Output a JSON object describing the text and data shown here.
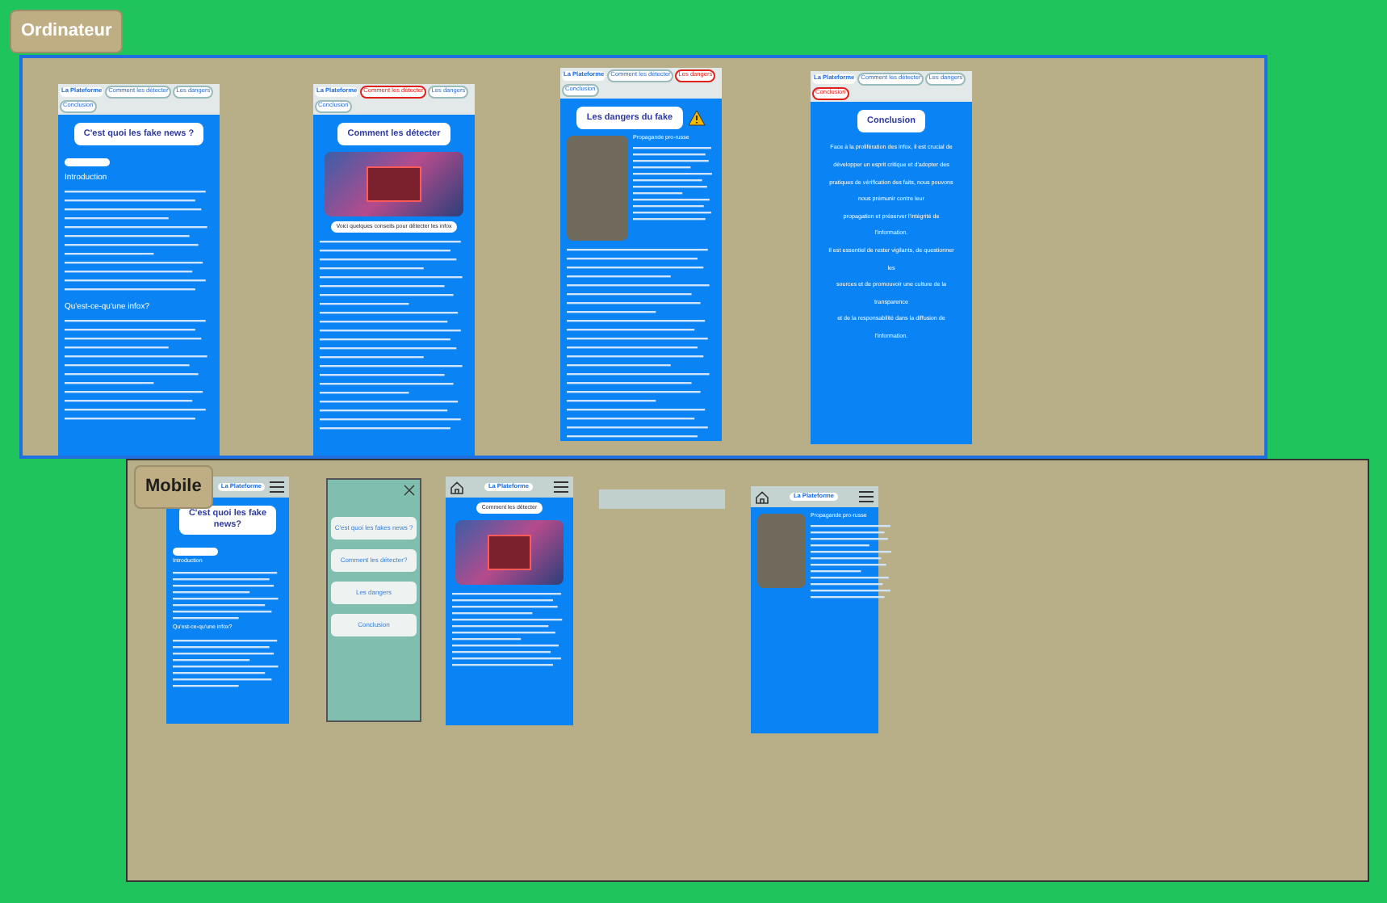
{
  "sections": [
    {
      "kind": "desktop",
      "label": "Ordinateur",
      "frames": [
        {
          "blocks": [
            {
              "kind": "nav",
              "brand": "La Plateforme",
              "tabs": [
                {
                  "label": "Comment les détecter",
                  "selected": false
                },
                {
                  "label": "Les dangers",
                  "selected": false
                },
                {
                  "label": "Conclusion",
                  "selected": false
                }
              ]
            },
            {
              "kind": "title",
              "text": "C'est quoi les fake news ?"
            },
            {
              "kind": "pill_blank"
            },
            {
              "kind": "heading",
              "text": "Introduction"
            },
            {
              "kind": "lines"
            },
            {
              "kind": "heading",
              "text": "Qu'est-ce-qu'une infox?"
            },
            {
              "kind": "lines"
            }
          ]
        },
        {
          "blocks": [
            {
              "kind": "nav",
              "brand": "La Plateforme",
              "tabs": [
                {
                  "label": "Comment les détecter",
                  "selected": true
                },
                {
                  "label": "Les dangers",
                  "selected": false
                },
                {
                  "label": "Conclusion",
                  "selected": false
                }
              ]
            },
            {
              "kind": "title",
              "text": "Comment les détecter"
            },
            {
              "kind": "poster"
            },
            {
              "kind": "pill",
              "text": "Voici quelques conseils pour détecter les infox"
            },
            {
              "kind": "longlines"
            }
          ]
        },
        {
          "blocks": [
            {
              "kind": "nav",
              "brand": "La Plateforme",
              "tabs": [
                {
                  "label": "Comment les détecter",
                  "selected": false
                },
                {
                  "label": "Les dangers",
                  "selected": true
                },
                {
                  "label": "Conclusion",
                  "selected": false
                }
              ]
            },
            {
              "kind": "title",
              "text": "Les dangers du fake",
              "warning": true
            },
            {
              "kind": "media_row",
              "heading": "Propagande pro-russe"
            },
            {
              "kind": "longlines"
            }
          ]
        },
        {
          "blocks": [
            {
              "kind": "nav",
              "brand": "La Plateforme",
              "tabs": [
                {
                  "label": "Comment les détecter",
                  "selected": false
                },
                {
                  "label": "Les dangers",
                  "selected": false
                },
                {
                  "label": "Conclusion",
                  "selected": true
                }
              ]
            },
            {
              "kind": "title",
              "text": "Conclusion"
            },
            {
              "kind": "paragraph",
              "lines": [
                "Face à la prolifération des infox, il est crucial de",
                "développer un esprit critique et d'adopter des",
                "pratiques de vérification des faits, nous pouvons",
                "nous prémunir contre leur",
                "propagation et préserver l'intégrité de",
                "l'information.",
                "Il est essentiel de rester vigilants, de questionner",
                "les",
                "sources et de promouvoir une culture de la",
                "transparence",
                "et de la responsabilité dans la diffusion de",
                "l'information."
              ]
            }
          ]
        }
      ]
    },
    {
      "kind": "mobile",
      "label": "Mobile",
      "frames": [
        {
          "blocks": [
            {
              "kind": "mobile_nav",
              "home": false,
              "brand": "La Plateforme"
            },
            {
              "kind": "title",
              "text": "C'est quoi les fake news?"
            },
            {
              "kind": "pill_blank"
            },
            {
              "kind": "heading",
              "text": "Introduction"
            },
            {
              "kind": "shortlines"
            },
            {
              "kind": "heading",
              "text": "Qu'est-ce-qu'une infox?"
            },
            {
              "kind": "shortlines"
            }
          ]
        },
        {
          "blocks": [
            {
              "kind": "menu",
              "items": [
                "C'est quoi les fakes news ?",
                "Comment les détecter?",
                "Les dangers",
                "Conclusion"
              ]
            }
          ]
        },
        {
          "blocks": [
            {
              "kind": "mobile_nav",
              "home": true,
              "brand": "La Plateforme"
            },
            {
              "kind": "pill",
              "text": "Comment les détecter"
            },
            {
              "kind": "poster"
            },
            {
              "kind": "lines"
            }
          ]
        },
        {
          "blocks": [
            {
              "kind": "placeholder_bar"
            }
          ]
        },
        {
          "blocks": [
            {
              "kind": "mobile_nav",
              "home": true,
              "brand": "La Plateforme"
            },
            {
              "kind": "media_row",
              "heading": "Propagande pro-russe"
            }
          ]
        }
      ]
    }
  ]
}
